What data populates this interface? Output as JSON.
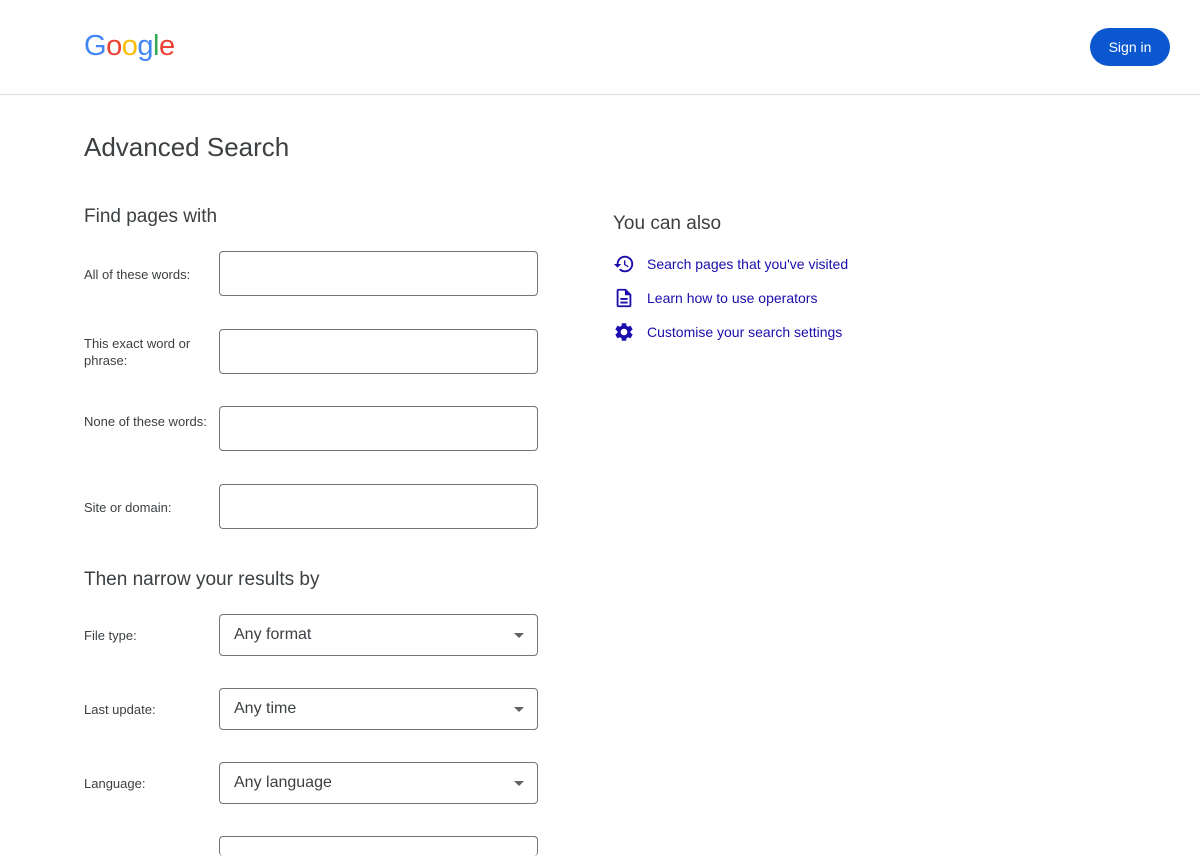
{
  "header": {
    "logo_letters": [
      {
        "char": "G",
        "color": "#4285f4"
      },
      {
        "char": "o",
        "color": "#ea4335"
      },
      {
        "char": "o",
        "color": "#fbbc05"
      },
      {
        "char": "g",
        "color": "#4285f4"
      },
      {
        "char": "l",
        "color": "#34a853"
      },
      {
        "char": "e",
        "color": "#ea4335"
      }
    ],
    "sign_in_label": "Sign in",
    "sign_in_color": "#0b57d0"
  },
  "page_title": "Advanced Search",
  "find_pages": {
    "title": "Find pages with",
    "fields": [
      {
        "label": "All of these words:",
        "value": ""
      },
      {
        "label": "This exact word or phrase:",
        "value": ""
      },
      {
        "label": "None of these words:",
        "value": ""
      },
      {
        "label": "Site or domain:",
        "value": ""
      }
    ]
  },
  "narrow": {
    "title": "Then narrow your results by",
    "fields": [
      {
        "label": "File type:",
        "selected": "Any format"
      },
      {
        "label": "Last update:",
        "selected": "Any time"
      },
      {
        "label": "Language:",
        "selected": "Any language"
      }
    ]
  },
  "you_can_also": {
    "title": "You can also",
    "links": [
      {
        "label": "Search pages that you've visited",
        "icon": "history-icon"
      },
      {
        "label": "Learn how to use operators",
        "icon": "document-icon"
      },
      {
        "label": "Customise your search settings",
        "icon": "gear-icon"
      }
    ],
    "link_color": "#1a0dab"
  }
}
